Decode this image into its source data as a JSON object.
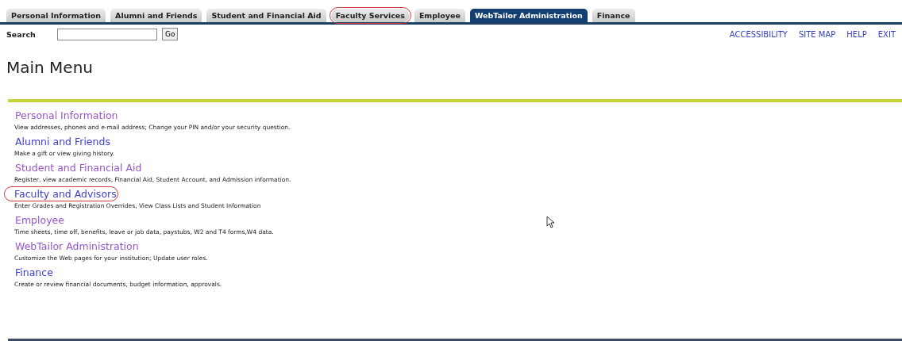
{
  "tabs": [
    {
      "label": "Personal Information",
      "selected": false,
      "circled": false
    },
    {
      "label": "Alumni and Friends",
      "selected": false,
      "circled": false
    },
    {
      "label": "Student and Financial Aid",
      "selected": false,
      "circled": false
    },
    {
      "label": "Faculty Services",
      "selected": false,
      "circled": true
    },
    {
      "label": "Employee",
      "selected": false,
      "circled": false
    },
    {
      "label": "WebTailor Administration",
      "selected": true,
      "circled": false
    },
    {
      "label": "Finance",
      "selected": false,
      "circled": false
    }
  ],
  "search": {
    "label": "Search",
    "button": "Go"
  },
  "top_links": [
    "ACCESSIBILITY",
    "SITE MAP",
    "HELP",
    "EXIT"
  ],
  "heading": "Main Menu",
  "menu": [
    {
      "title": "Personal Information",
      "visited": true,
      "circled": false,
      "description": "View addresses, phones and e-mail address; Change your PIN and/or your security question."
    },
    {
      "title": "Alumni and Friends",
      "visited": false,
      "circled": false,
      "description": "Make a gift or view giving history."
    },
    {
      "title": "Student and Financial Aid",
      "visited": true,
      "circled": false,
      "description": "Register, view academic records, Financial Aid, Student Account, and Admission information."
    },
    {
      "title": "Faculty and Advisors",
      "visited": false,
      "circled": true,
      "description": "Enter Grades and Registration Overrides, View Class Lists and Student Information"
    },
    {
      "title": "Employee",
      "visited": true,
      "circled": false,
      "description": "Time sheets, time off, benefits, leave or job data, paystubs, W2 and T4 forms,W4 data."
    },
    {
      "title": "WebTailor Administration",
      "visited": true,
      "circled": false,
      "description": "Customize the Web pages for your institution; Update user roles."
    },
    {
      "title": "Finance",
      "visited": false,
      "circled": false,
      "description": "Create or review financial documents, budget information, approvals."
    }
  ]
}
